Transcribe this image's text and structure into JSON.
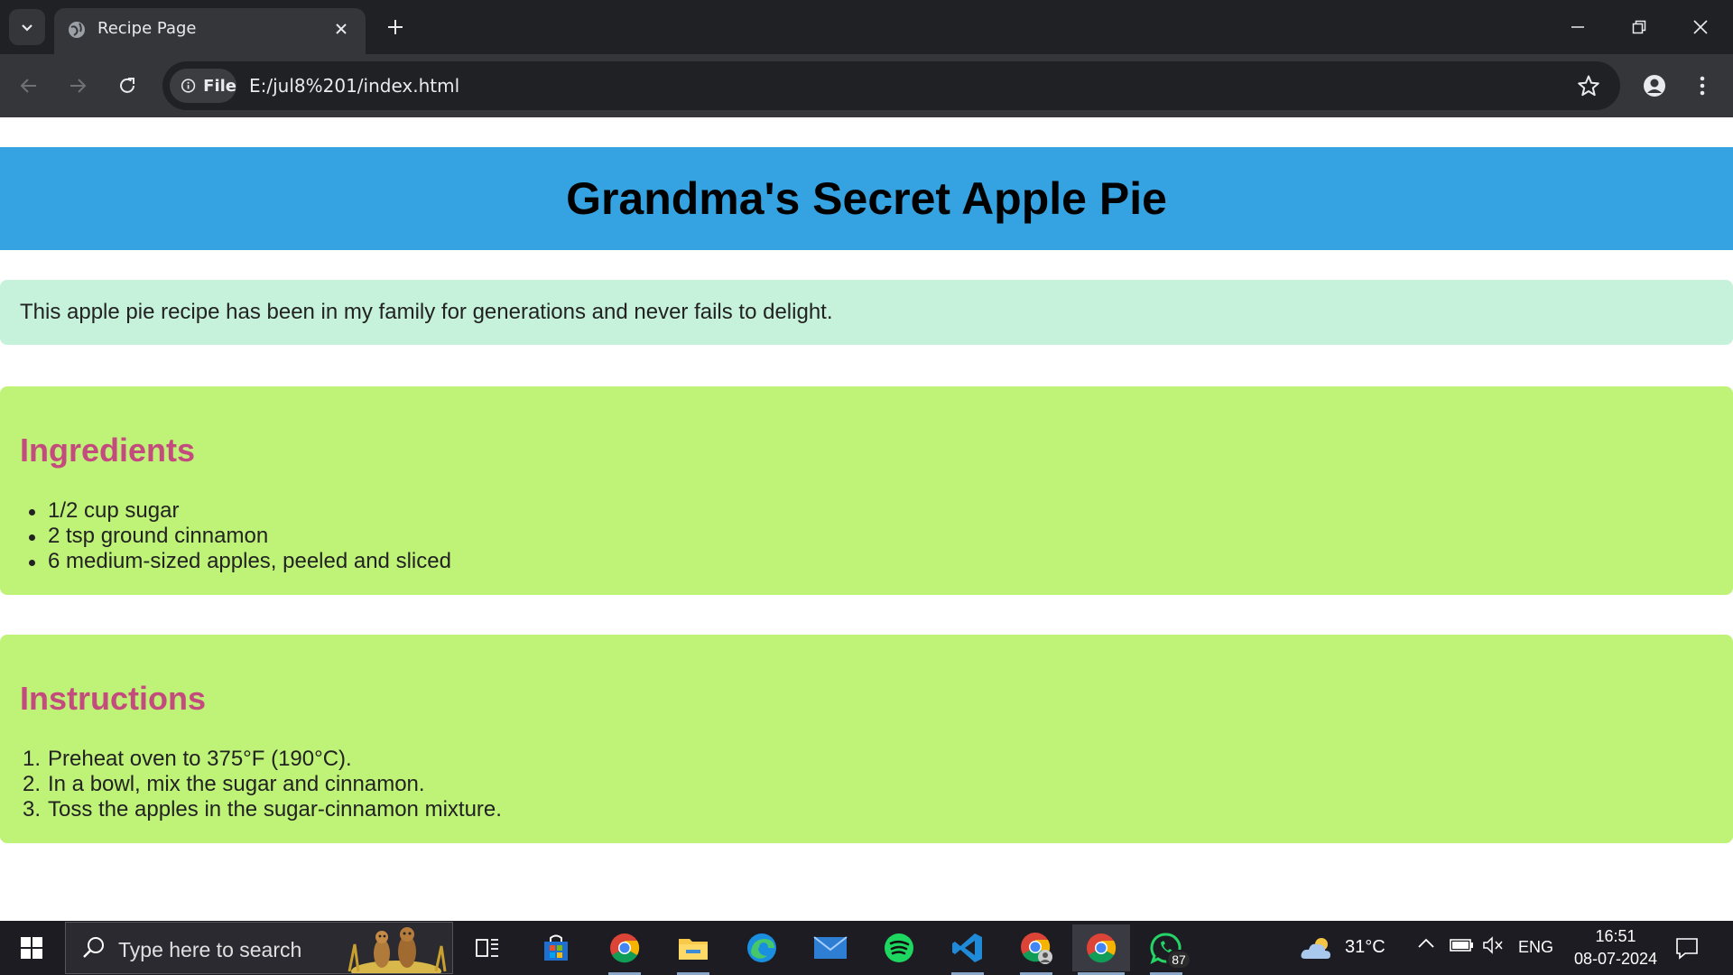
{
  "browser": {
    "tab_title": "Recipe Page",
    "site_chip_label": "File",
    "url": "E:/jul8%201/index.html"
  },
  "page": {
    "title": "Grandma's Secret Apple Pie",
    "intro": "This apple pie recipe has been in my family for generations and never fails to delight.",
    "ingredients": {
      "heading": "Ingredients",
      "items": [
        "1/2 cup sugar",
        "2 tsp ground cinnamon",
        "6 medium-sized apples, peeled and sliced"
      ]
    },
    "instructions": {
      "heading": "Instructions",
      "steps": [
        {
          "num": "1.",
          "text": "Preheat oven to 375°F (190°C)."
        },
        {
          "num": "2.",
          "text": "In a bowl, mix the sugar and cinnamon."
        },
        {
          "num": "3.",
          "text": "Toss the apples in the sugar-cinnamon mixture."
        }
      ]
    }
  },
  "taskbar": {
    "search_placeholder": "Type here to search",
    "weather": "31°C",
    "language": "ENG",
    "time": "16:51",
    "date": "08-07-2024",
    "whatsapp_badge": "87"
  },
  "colors": {
    "header_bg": "#35a3e1",
    "intro_bg": "#c6f1db",
    "card_bg": "#bef377",
    "heading_color": "#c44b7d"
  }
}
